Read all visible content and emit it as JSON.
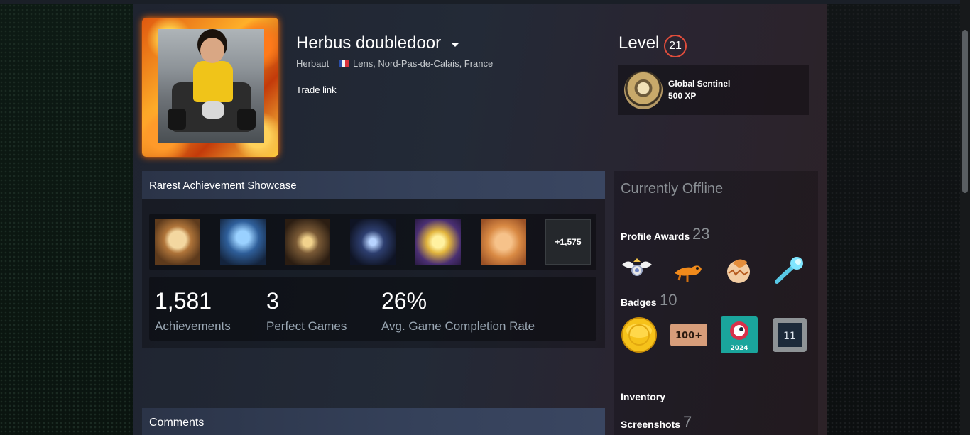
{
  "profile": {
    "persona_name": "Herbus doubledoor",
    "real_name": "Herbaut",
    "location": "Lens, Nord-Pas-de-Calais, France",
    "trade_link": "Trade link"
  },
  "level": {
    "label": "Level",
    "value": "21"
  },
  "featured_badge": {
    "name": "Global Sentinel",
    "xp": "500 XP"
  },
  "showcase": {
    "title": "Rarest Achievement Showcase",
    "achievement_icons": [
      "ram-rider-icon",
      "frost-wizard-icon",
      "glowing-doorway-icon",
      "dark-demon-icon",
      "golden-clover-icon",
      "joined-hands-icon"
    ],
    "more_count": "+1,575",
    "stats": [
      {
        "value": "1,581",
        "label": "Achievements"
      },
      {
        "value": "3",
        "label": "Perfect Games"
      },
      {
        "value": "26%",
        "label": "Avg. Game Completion Rate"
      }
    ]
  },
  "comments": {
    "title": "Comments"
  },
  "sidebar": {
    "status": "Currently Offline",
    "profile_awards": {
      "label": "Profile Awards",
      "count": "23"
    },
    "award_icons": [
      "winged-ball-icon",
      "orange-lizard-icon",
      "cracked-egg-icon",
      "comet-icon"
    ],
    "badges": {
      "label": "Badges",
      "count": "10"
    },
    "badge_icons": [
      "gold-coin-icon",
      "100-plus-badge-icon",
      "steam-2024-badge-icon",
      "years-11-badge-icon"
    ],
    "steam_2024_text": "2024",
    "years_text": "11",
    "hundred_plus_text": "100+",
    "inventory": "Inventory",
    "screenshots": {
      "label": "Screenshots",
      "count": "7"
    }
  }
}
